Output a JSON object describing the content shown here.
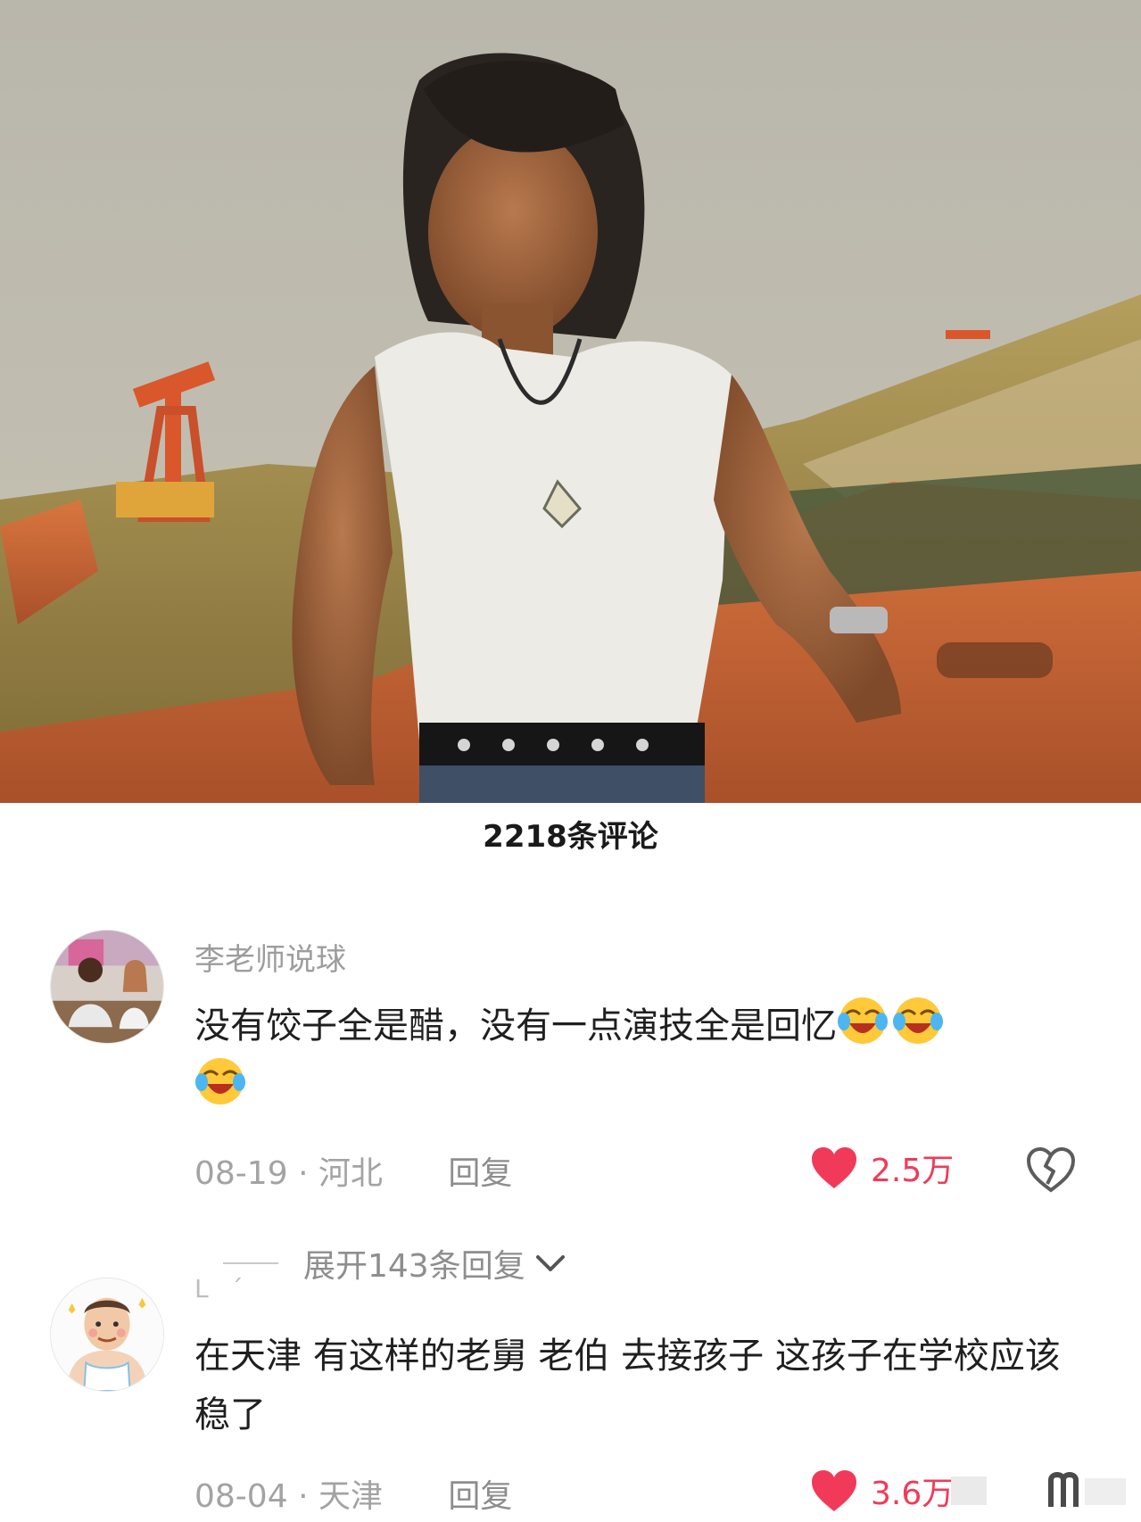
{
  "comment_count": "2218条评论",
  "comments": [
    {
      "username": "李老师说球",
      "text": "没有饺子全是醋，没有一点演技全是回忆",
      "emoji_count": 3,
      "date": "08-19",
      "location": "河北",
      "reply_label": "回复",
      "likes": "2.5万",
      "avatar_icon": "avatar-photo-icon"
    },
    {
      "username": "L ˊ",
      "text": "在天津 有这样的老舅 老伯 去接孩子 这孩子在学校应该稳了",
      "date": "08-04",
      "location": "天津",
      "reply_label": "回复",
      "likes": "3.6万",
      "avatar_icon": "cartoon-man-avatar-icon"
    }
  ],
  "expand_replies": "展开143条回复",
  "colors": {
    "like": "#f13a59",
    "muted": "#a3a3a3",
    "text": "#1f1f1f"
  },
  "icons": [
    "heart-icon",
    "broken-heart-icon",
    "chevron-down-icon",
    "laughing-emoji-icon"
  ]
}
